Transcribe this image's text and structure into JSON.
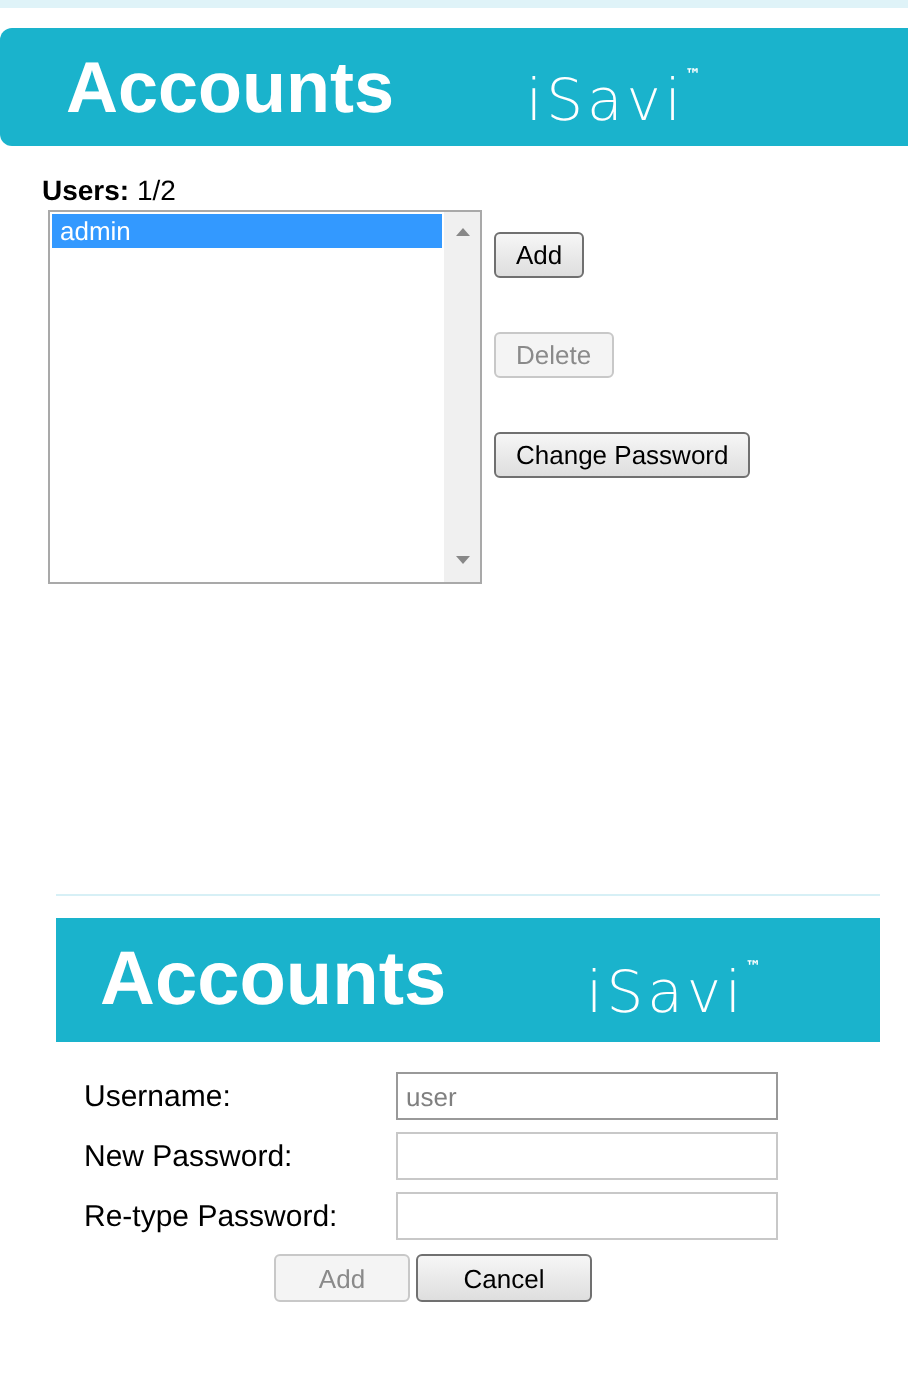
{
  "main": {
    "header": {
      "title": "Accounts",
      "logo": "iSavi$^{™}$"
    },
    "users_label": "Users:",
    "users_count": "1/2",
    "users": [
      {
        "name": "admin",
        "selected": true
      }
    ],
    "buttons": [
      {
        "label": "Add",
        "disabled": false
      },
      {
        "label": "Delete",
        "disabled": true
      },
      {
        "label": "Change Password",
        "disabled": false
      }
    ]
  },
  "add_dialog": {
    "header": {
      "title": "Accounts",
      "logo": "iSavi$^{™}$"
    },
    "fields": [
      {
        "label": "Username:",
        "placeholder": "user"
      },
      {
        "label": "New Password:"
      },
      {
        "label": "Re-type Password:"
      }
    ],
    "buttons": [
      {
        "label": "Add",
        "disabled": true
      },
      {
        "label": "Cancel",
        "disabled": false
      }
    ]
  }
}
